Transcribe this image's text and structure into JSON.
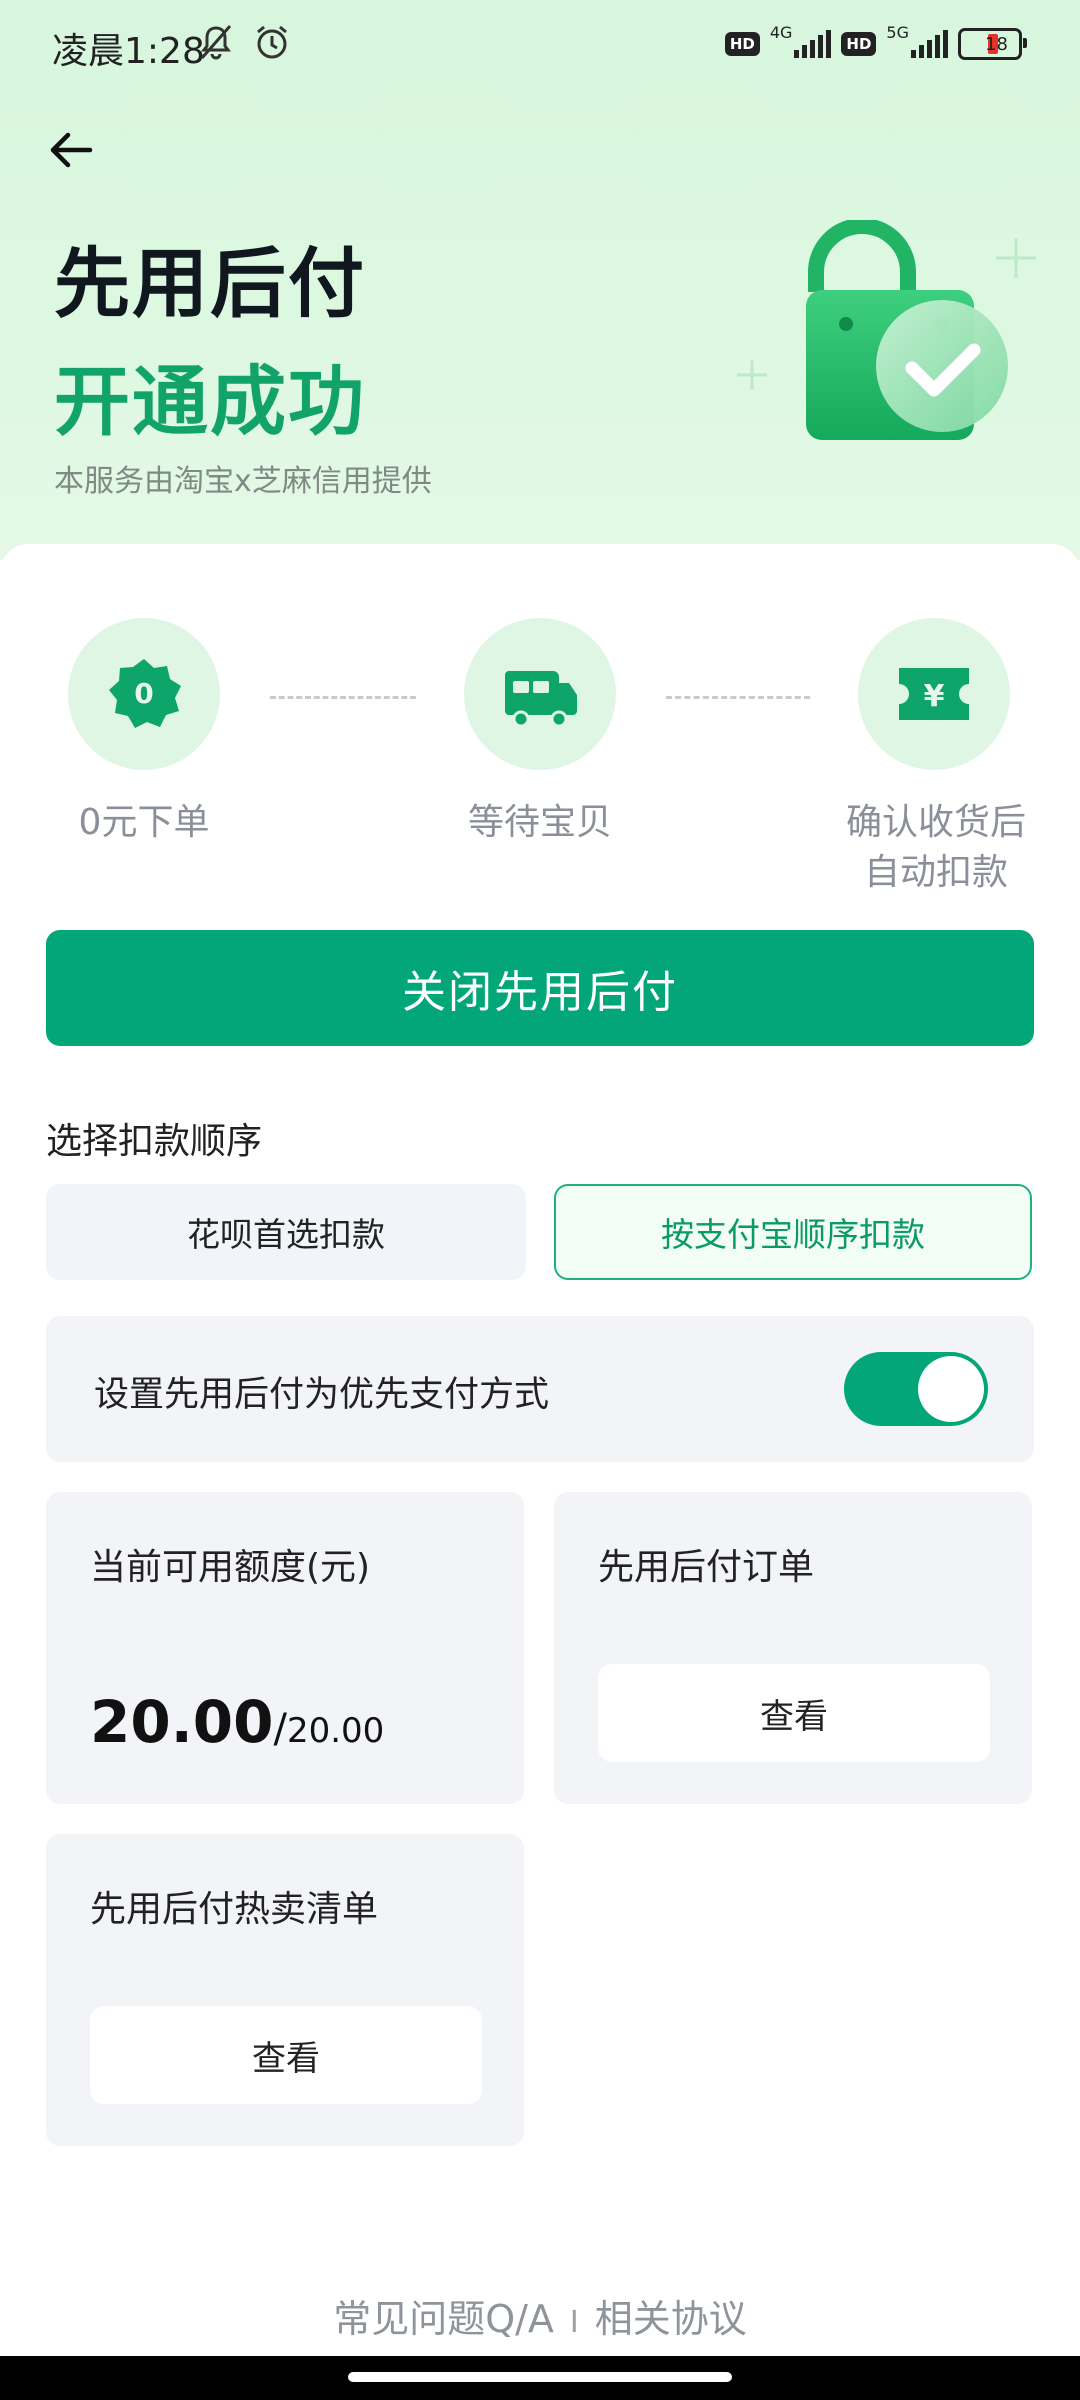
{
  "status_bar": {
    "time": "凌晨1:28",
    "hd1": "HD",
    "net1": "4G",
    "hd2": "HD",
    "net2": "5G",
    "battery": "18"
  },
  "header": {
    "title_line1": "先用后付",
    "title_line2": "开通成功",
    "subtitle": "本服务由淘宝x芝麻信用提供"
  },
  "steps": [
    {
      "icon_text": "0",
      "label_line1": "0元下单",
      "label_line2": ""
    },
    {
      "icon_text": "",
      "label_line1": "等待宝贝",
      "label_line2": ""
    },
    {
      "icon_text": "¥",
      "label_line1": "确认收货后",
      "label_line2": "自动扣款"
    }
  ],
  "primary_button": "关闭先用后付",
  "deduction": {
    "title": "选择扣款顺序",
    "option_a": "花呗首选扣款",
    "option_b": "按支付宝顺序扣款"
  },
  "priority_setting": {
    "label": "设置先用后付为优先支付方式",
    "enabled": true
  },
  "quota_panel": {
    "title": "当前可用额度(元)",
    "available": "20.00",
    "slash": "/",
    "total": "20.00"
  },
  "orders_panel": {
    "title": "先用后付订单",
    "button": "查看"
  },
  "hot_list_panel": {
    "title": "先用后付热卖清单",
    "button": "查看"
  },
  "footer": {
    "faq": "常见问题Q/A",
    "separator": "I",
    "agreement": "相关协议"
  },
  "colors": {
    "brand_green": "#02a678",
    "title_green": "#12a36b",
    "header_bg": "#d8f6dd"
  }
}
